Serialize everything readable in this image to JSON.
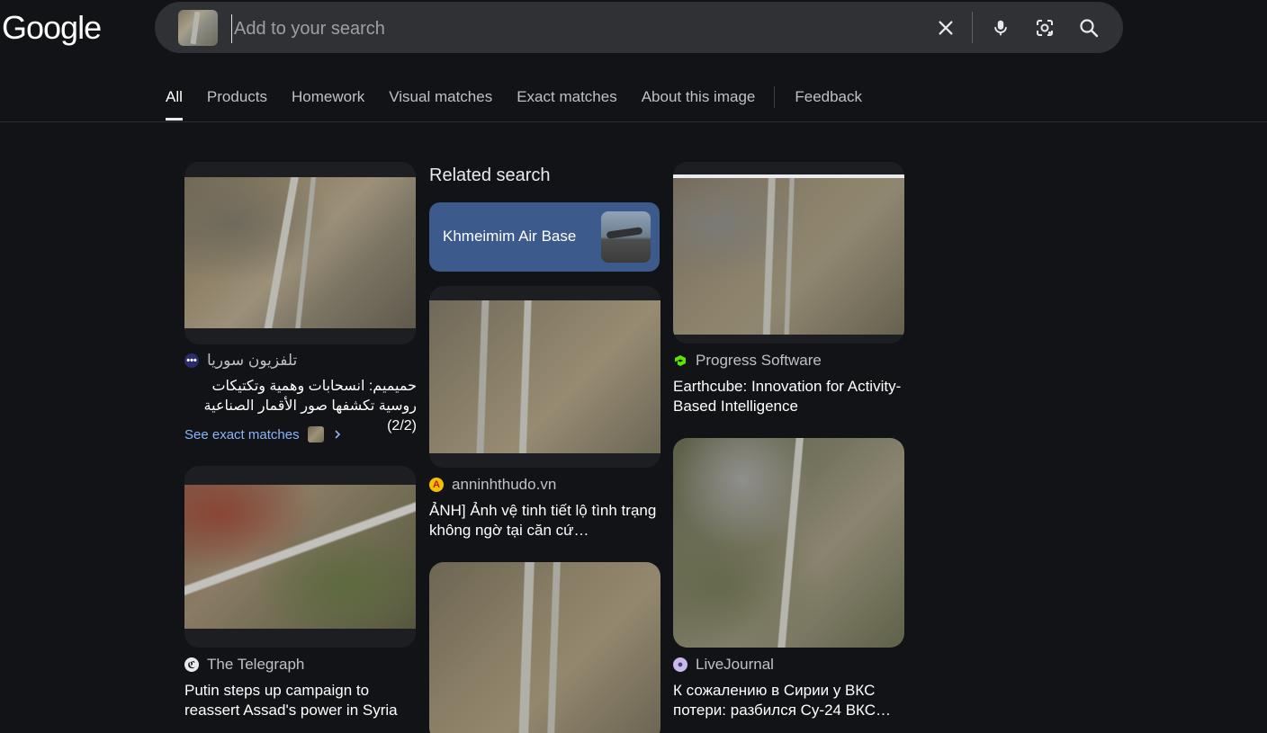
{
  "header": {
    "logo_text": "Google",
    "search_placeholder": "Add to your search",
    "icons": [
      "close-icon",
      "microphone-icon",
      "lens-icon",
      "search-icon"
    ]
  },
  "tabs": [
    {
      "label": "All",
      "active": true
    },
    {
      "label": "Products"
    },
    {
      "label": "Homework"
    },
    {
      "label": "Visual matches"
    },
    {
      "label": "Exact matches"
    },
    {
      "label": "About this image"
    },
    {
      "label": "Feedback"
    }
  ],
  "results": {
    "col1": [
      {
        "source": "تلفزيون سوريا",
        "title": "حميميم: انسحابات وهمية وتكتيكات روسية تكشفها صور الأقمار الصناعية (2/2)",
        "exact_link": "See exact matches"
      },
      {
        "source": "The Telegraph",
        "title": "Putin steps up campaign to reassert Assad's power in Syria"
      }
    ],
    "col2": {
      "related_heading": "Related search",
      "related_chip": "Khmeimim Air Base",
      "items": [
        {
          "source": "anninhthudo.vn",
          "title": "ẢNH] Ảnh vệ tinh tiết lộ tình trạng không ngờ tại căn cứ…"
        }
      ]
    },
    "col3": [
      {
        "source": "Progress Software",
        "title": "Earthcube: Innovation for Activity-Based Intelligence"
      },
      {
        "source": "LiveJournal",
        "title": "К сожалению в Сирии у ВКС потери: разбился Су-24 ВКС…"
      }
    ]
  },
  "colors": {
    "background": "#121317",
    "search_bar": "#303134",
    "link": "#8ab4f8",
    "related_chip": "#3c5a8c"
  }
}
